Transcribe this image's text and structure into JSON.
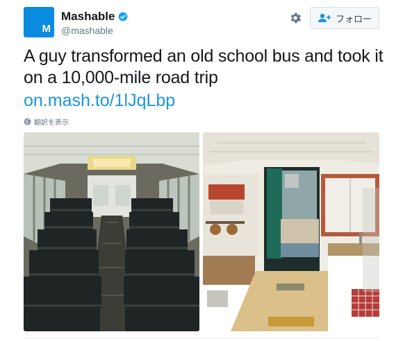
{
  "user": {
    "display_name": "Mashable",
    "handle": "@mashable",
    "avatar_letter": "M",
    "verified": true
  },
  "actions": {
    "follow_label": "フォロー",
    "settings_icon": "gear-icon"
  },
  "tweet": {
    "text": "A guy transformed an old school bus and took it on a 10,000-mile road trip",
    "link": "on.mash.to/1lJqLbp",
    "translate_label": "翻訳を表示"
  },
  "media": [
    {
      "description": "school bus interior with rows of seats"
    },
    {
      "description": "converted bus interior with kitchen and bed"
    }
  ],
  "colors": {
    "avatar": "#0a8be0",
    "link": "#1b95e0",
    "verified": "#1da1f2",
    "text": "#14171a",
    "secondary": "#657786"
  }
}
